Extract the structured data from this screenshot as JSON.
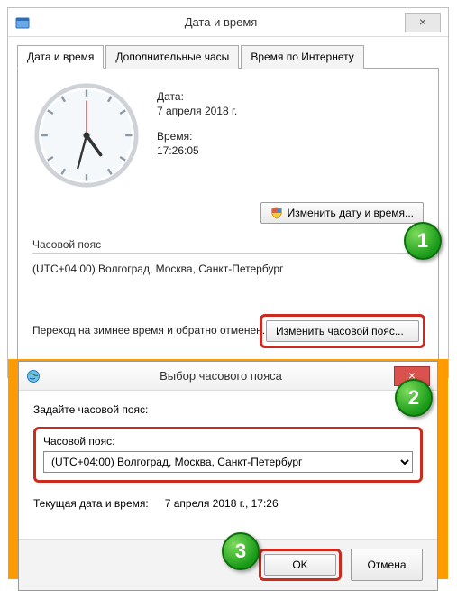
{
  "parent": {
    "title": "Дата и время",
    "tabs": [
      "Дата и время",
      "Дополнительные часы",
      "Время по Интернету"
    ],
    "date_label": "Дата:",
    "date_value": "7 апреля 2018 г.",
    "time_label": "Время:",
    "time_value": "17:26:05",
    "change_datetime": "Изменить дату и время...",
    "tz_header": "Часовой пояс",
    "tz_value": "(UTC+04:00) Волгоград, Москва, Санкт-Петербург",
    "change_tz": "Изменить часовой пояс...",
    "dst_note": "Переход на зимнее время и обратно отменен."
  },
  "child": {
    "title": "Выбор часового пояса",
    "prompt": "Задайте часовой пояс:",
    "tz_label": "Часовой пояс:",
    "tz_selected": "(UTC+04:00) Волгоград, Москва, Санкт-Петербург",
    "current_label": "Текущая дата и время:",
    "current_value": "7 апреля 2018 г., 17:26",
    "ok": "OK",
    "cancel": "Отмена"
  },
  "steps": {
    "s1": "1",
    "s2": "2",
    "s3": "3"
  }
}
